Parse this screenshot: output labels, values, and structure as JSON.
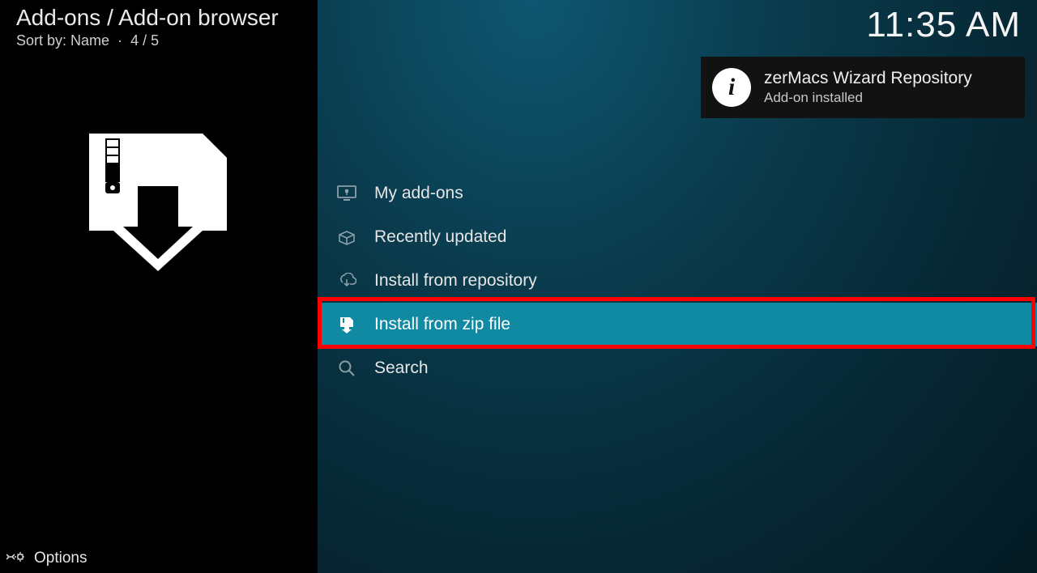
{
  "header": {
    "breadcrumb": "Add-ons / Add-on browser",
    "sort_label": "Sort by: Name",
    "position": "4 / 5",
    "clock": "11:35 AM"
  },
  "menu": {
    "items": [
      {
        "label": "My add-ons"
      },
      {
        "label": "Recently updated"
      },
      {
        "label": "Install from repository"
      },
      {
        "label": "Install from zip file"
      },
      {
        "label": "Search"
      }
    ],
    "selected_index": 3
  },
  "notification": {
    "title": "zerMacs Wizard Repository",
    "subtitle": "Add-on installed"
  },
  "footer": {
    "options_label": "Options"
  },
  "highlight": {
    "target_menu_index": 3
  }
}
